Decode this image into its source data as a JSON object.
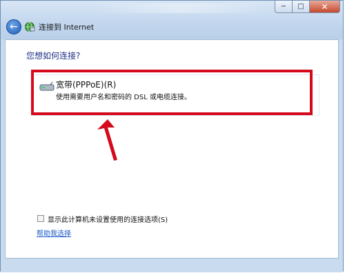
{
  "window": {
    "title": "连接到 Internet",
    "caption": {
      "minimize": "−",
      "maximize": "□",
      "close": "✕"
    }
  },
  "nav": {
    "back_icon": "←"
  },
  "main": {
    "heading": "您想如何连接?",
    "option": {
      "title": "宽带(PPPoE)(R)",
      "description": "使用需要用户名和密码的 DSL 或电缆连接。",
      "icon": "modem-icon"
    },
    "show_unsetup": {
      "label": "显示此计算机未设置使用的连接选项(S)",
      "checked": false
    },
    "help_link": "帮助我选择"
  },
  "colors": {
    "highlight": "#d4091c",
    "heading": "#1e3287",
    "link": "#1d59c9"
  }
}
